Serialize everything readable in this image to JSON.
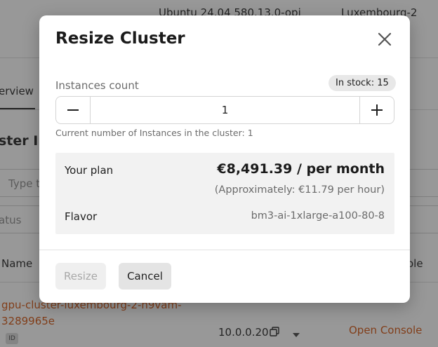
{
  "background": {
    "os_image": "Ubuntu 24.04 580.13.0-opi",
    "region": "Luxembourg-2",
    "tab_overview": "erview",
    "section_title": "ster Ins",
    "search_placeholder": "Type t",
    "status_placeholder": "atus",
    "col_name": "Name",
    "col_console": "ole",
    "instance_name_line1": "gpu-cluster-luxembourg-2-h9vam-",
    "instance_name_line2": "3289965e",
    "id_badge": "ID",
    "ip_address": "10.0.0.20",
    "open_console": "Open Console"
  },
  "modal": {
    "title": "Resize Cluster",
    "instances_label": "Instances count",
    "stock_badge": "In stock: 15",
    "count_value": "1",
    "hint": "Current number of Instances in the cluster: 1",
    "plan_label": "Your plan",
    "plan_price": "€8,491.39 / per month",
    "plan_approx": "(Approximately: €11.79 per hour)",
    "flavor_label": "Flavor",
    "flavor_value": "bm3-ai-1xlarge-a100-80-8",
    "resize_button": "Resize",
    "cancel_button": "Cancel"
  },
  "icons": {
    "close": "close-icon",
    "minus": "minus-icon",
    "plus": "plus-icon",
    "copy": "copy-icon",
    "caret": "caret-down-icon"
  },
  "colors": {
    "link_orange": "#d4540f",
    "overlay": "rgba(40,40,40,0.48)"
  }
}
